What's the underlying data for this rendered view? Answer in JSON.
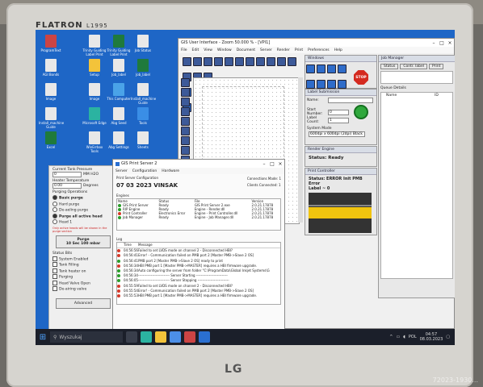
{
  "monitor": {
    "brand": "FLATRON",
    "model": "L1995",
    "maker": "LG"
  },
  "desktop_icons": [
    {
      "label": "ProgramText",
      "color": "#c44"
    },
    {
      "label": "Trinity Guiding Label Print",
      "color": "#e8e8e8"
    },
    {
      "label": "Trinity Guiding Label Print",
      "color": "#1f7a3c"
    },
    {
      "label": "Job Status",
      "color": "#e8e8e8"
    },
    {
      "label": "AGl Bonds",
      "color": "#e8e8e8"
    },
    {
      "label": "Setup",
      "color": "#f3c33a"
    },
    {
      "label": "Job_label",
      "color": "#e8e8e8"
    },
    {
      "label": "Job_label",
      "color": "#1f7a3c"
    },
    {
      "label": "Image",
      "color": "#e8e8e8"
    },
    {
      "label": "Image",
      "color": "#e8e8e8"
    },
    {
      "label": "This Computer",
      "color": "#4aa3e8"
    },
    {
      "label": "Install_machine Guide",
      "color": "#e8e8e8"
    },
    {
      "label": "Install_machine Guide",
      "color": "#e8e8e8"
    },
    {
      "label": "Microsoft Edge",
      "color": "#2bb3a1"
    },
    {
      "label": "Abg Seed",
      "color": "#e8e8e8"
    },
    {
      "label": "Tools",
      "color": "#3a8ee6"
    },
    {
      "label": "Excel",
      "color": "#1f7a3c"
    },
    {
      "label": "WinErrbox Tools",
      "color": "#e8e8e8"
    },
    {
      "label": "Abg Settings",
      "color": "#e8e8e8"
    },
    {
      "label": "Sheets",
      "color": "#e8e8e8"
    }
  ],
  "gis_ui": {
    "title": "GIS User Interface - Zoom 50.000 % - [VPI1]",
    "menu": [
      "File",
      "Edit",
      "View",
      "Window",
      "Document",
      "Server",
      "Render",
      "Print",
      "Preferences",
      "Help"
    ],
    "windows_panel": {
      "title": "Windows",
      "stop": "STOP"
    },
    "label_submission": {
      "title": "Label Submission",
      "name_label": "Name:",
      "start_number_label": "Start Number:",
      "start_number_value": "0",
      "label_count_label": "Label Count:",
      "label_count_value": "1",
      "system_mode_label": "System Mode",
      "system_mode_value": "600dpi x 600dpi (2dpi) Black"
    },
    "render_engine": {
      "title": "Render Engine",
      "status": "Status:  Ready"
    },
    "print_controller": {
      "title": "Print Controller",
      "status": "Status:  ERROR Init PMB Error",
      "label": "Label ~ 0"
    },
    "job_manager": {
      "title": "Job Manager",
      "tabs": [
        "Status",
        "Contr. label",
        "Print"
      ],
      "queue_title": "Queue Details",
      "col_name": "Name",
      "col_id": "ID"
    }
  },
  "print_server": {
    "title": "GIS Print Server 2",
    "menu": [
      "Server",
      "Configuration",
      "Hardware"
    ],
    "config_label": "Print Server Configuration",
    "server_name": "07 03 2023 VINSAK",
    "connections_label": "Connections Made:",
    "connections_value": "1",
    "clients_label": "Clients Connected:",
    "clients_value": "1",
    "engines_title": "Engines",
    "engine_headers": [
      "Name",
      "Status",
      "File",
      "Version"
    ],
    "engines": [
      {
        "name": "GIS Print Server",
        "status": "Ready",
        "file": "GIS Print Server 2.exe",
        "version": "2.0.21.17878",
        "color": "#2a9d2a"
      },
      {
        "name": "RIP Engine",
        "status": "Ready",
        "file": "Engine - Render.dll",
        "version": "2.0.21.17878",
        "color": "#2a9d2a"
      },
      {
        "name": "Print Controller",
        "status": "Electronics Error",
        "file": "Engine - Print Controller.dll",
        "version": "2.0.21.17878",
        "color": "#d43a2a"
      },
      {
        "name": "Job Manager",
        "status": "Ready",
        "file": "Engine - Job Manager.dll",
        "version": "2.0.21.17878",
        "color": "#2a9d2a"
      }
    ],
    "log_title": "Log",
    "log_headers": [
      "Time",
      "Message"
    ],
    "log": [
      {
        "time": "04:56:56",
        "msg": "Failed to set LVDS mode on channel 2 - Disconnected HBI?",
        "color": "#d43a2a"
      },
      {
        "time": "04:56:41",
        "msg": "Error! - Communication failed on PMB port 2 [Master PMB->Slave 2 OS]",
        "color": "#d43a2a"
      },
      {
        "time": "04:56:41",
        "msg": "PMB port 2 [Master PMB->Slave 2 OS] ready to print",
        "color": "#2a9d2a"
      },
      {
        "time": "04:56:34",
        "msg": "HBI PMB port 1 [Master PMB->MASTER] requires a HBI firmware upgrade.",
        "color": "#d43a2a"
      },
      {
        "time": "04:56:34",
        "msg": "Auto configuring the server from folder \"C:\\ProgramData\\Global Inkjet Systems\\G",
        "color": "#2a9d2a"
      },
      {
        "time": "04:56:34",
        "msg": "--------------------------- Server Starting ---------------------------",
        "color": "#2a9d2a"
      },
      {
        "time": "04:56:05",
        "msg": "--------------------------- Server Stopping ---------------------------",
        "color": "#2a9d2a"
      },
      {
        "time": "04:55:59",
        "msg": "Failed to set LVDS mode on channel 2 - Disconnected HBI?",
        "color": "#d43a2a"
      },
      {
        "time": "04:55:54",
        "msg": "Error! - Communication failed on PMB port 2 [Master PMB->Slave 2 OS]",
        "color": "#d43a2a"
      },
      {
        "time": "04:55:53",
        "msg": "HBI PMB port 1 [Master PMB->MASTER] requires a HBI firmware upgrade.",
        "color": "#d43a2a"
      }
    ]
  },
  "left_panel": {
    "pressure_label": "Current Tank Pressure",
    "pressure_value": "0",
    "pressure_unit": "MM H2O",
    "heater_label": "Heater Temperature",
    "heater_value": "0.00",
    "heater_unit": "Degrees",
    "purge_label": "Purging Operations",
    "purge_options": [
      {
        "label": "Basic purge",
        "on": true
      },
      {
        "label": "Hard purge",
        "on": false
      },
      {
        "label": "De-aeling purge",
        "on": false
      },
      {
        "label": "Purge all active head",
        "on": true
      },
      {
        "label": "Head 1",
        "on": false
      }
    ],
    "note": "Only active heads will be shown in the purge section",
    "purge_button": "Purge\n10 Sec 100 mbar",
    "status_label": "Status Bits",
    "status_bits": [
      "System Enabled",
      "Tank Filling",
      "Tank heater on",
      "Purging",
      "Head Valve Open",
      "De-airing valve"
    ],
    "advanced_button": "Advanced"
  },
  "taskbar": {
    "search": "Wyszukaj",
    "lang": "POL",
    "time": "04:57",
    "date": "08.03.2023"
  },
  "watermark": "72023-1930..."
}
